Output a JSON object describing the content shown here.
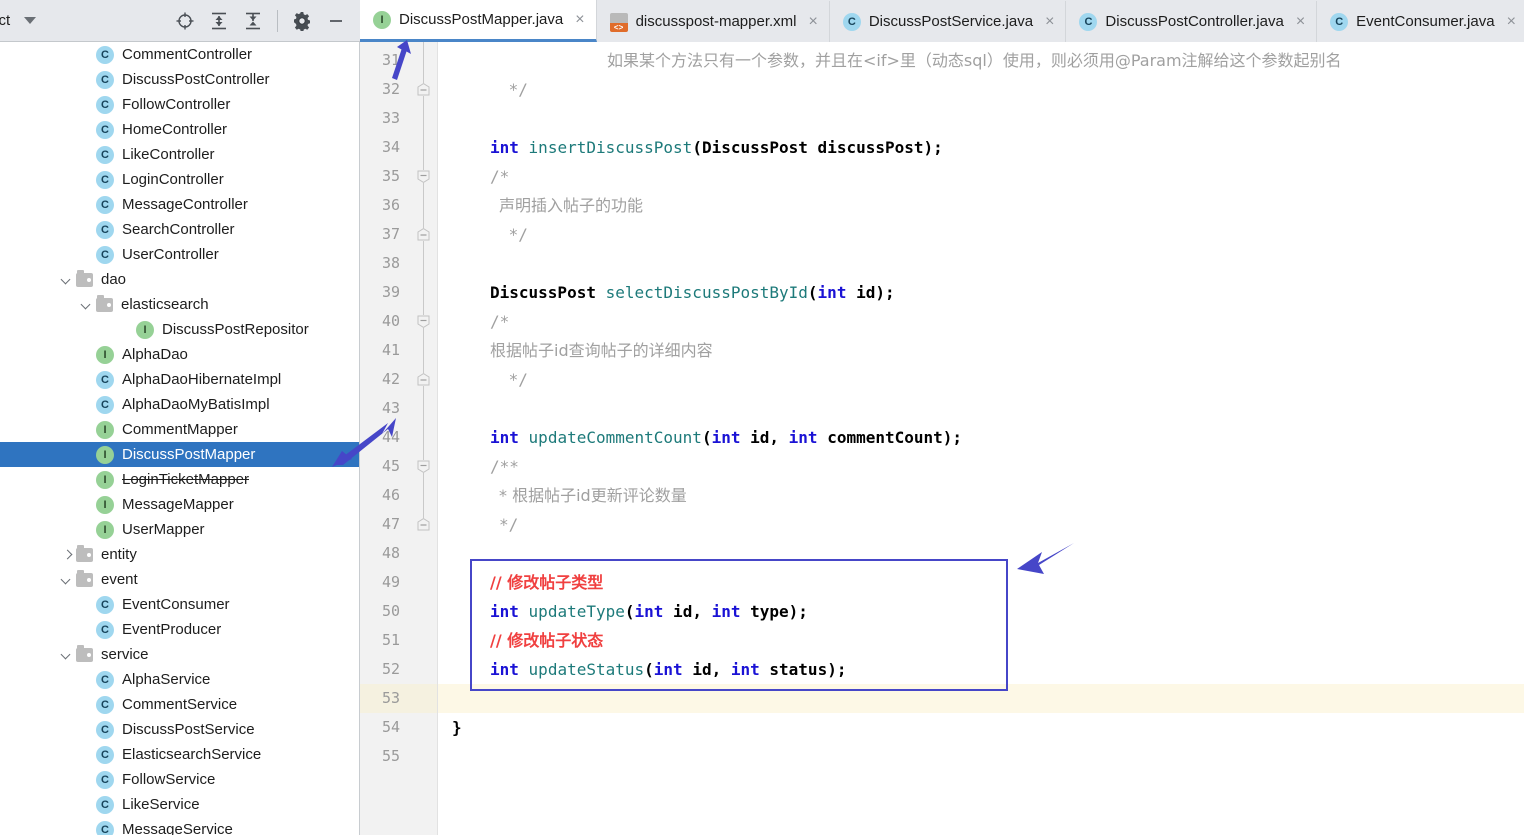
{
  "project_panel": {
    "title": "ect",
    "title_full": "Project",
    "dropdown_icon": "chevron-down-icon",
    "toolbar": [
      {
        "name": "locate-target-icon",
        "label": "Select Opened File"
      },
      {
        "name": "expand-all-icon",
        "label": "Expand All"
      },
      {
        "name": "collapse-all-icon",
        "label": "Collapse All"
      },
      {
        "name": "gear-icon",
        "label": "Settings"
      },
      {
        "name": "minimize-icon",
        "label": "Hide"
      }
    ]
  },
  "tabs": [
    {
      "label": "DiscussPostMapper.java",
      "icon": "interface-icon",
      "active": true,
      "close": "×"
    },
    {
      "label": "discusspost-mapper.xml",
      "icon": "xml-file-icon",
      "active": false,
      "close": "×"
    },
    {
      "label": "DiscussPostService.java",
      "icon": "class-icon",
      "active": false,
      "close": "×"
    },
    {
      "label": "DiscussPostController.java",
      "icon": "class-icon",
      "active": false,
      "close": "×"
    },
    {
      "label": "EventConsumer.java",
      "icon": "class-icon",
      "active": false,
      "close": "×"
    }
  ],
  "tree": [
    {
      "label": "CommentController",
      "icon": "class-icon",
      "indent": 5,
      "type": "file"
    },
    {
      "label": "DiscussPostController",
      "icon": "class-icon",
      "indent": 5,
      "type": "file"
    },
    {
      "label": "FollowController",
      "icon": "class-icon",
      "indent": 5,
      "type": "file"
    },
    {
      "label": "HomeController",
      "icon": "class-icon",
      "indent": 5,
      "type": "file"
    },
    {
      "label": "LikeController",
      "icon": "class-icon",
      "indent": 5,
      "type": "file"
    },
    {
      "label": "LoginController",
      "icon": "class-icon",
      "indent": 5,
      "type": "file"
    },
    {
      "label": "MessageController",
      "icon": "class-icon",
      "indent": 5,
      "type": "file"
    },
    {
      "label": "SearchController",
      "icon": "class-icon",
      "indent": 5,
      "type": "file"
    },
    {
      "label": "UserController",
      "icon": "class-icon",
      "indent": 5,
      "type": "file"
    },
    {
      "label": "dao",
      "icon": "folder-icon",
      "indent": 4,
      "type": "folder",
      "expanded": true
    },
    {
      "label": "elasticsearch",
      "icon": "folder-icon",
      "indent": 5,
      "type": "folder",
      "expanded": true
    },
    {
      "label": "DiscussPostRepositor",
      "icon": "interface-icon",
      "indent": 7,
      "type": "file",
      "clipped": true
    },
    {
      "label": "AlphaDao",
      "icon": "interface-icon",
      "indent": 5,
      "type": "file"
    },
    {
      "label": "AlphaDaoHibernateImpl",
      "icon": "class-icon",
      "indent": 5,
      "type": "file"
    },
    {
      "label": "AlphaDaoMyBatisImpl",
      "icon": "class-icon",
      "indent": 5,
      "type": "file"
    },
    {
      "label": "CommentMapper",
      "icon": "interface-icon",
      "indent": 5,
      "type": "file"
    },
    {
      "label": "DiscussPostMapper",
      "icon": "interface-icon",
      "indent": 5,
      "type": "file",
      "selected": true
    },
    {
      "label": "LoginTicketMapper",
      "icon": "interface-icon",
      "indent": 5,
      "type": "file",
      "strikethrough": true
    },
    {
      "label": "MessageMapper",
      "icon": "interface-icon",
      "indent": 5,
      "type": "file"
    },
    {
      "label": "UserMapper",
      "icon": "interface-icon",
      "indent": 5,
      "type": "file"
    },
    {
      "label": "entity",
      "icon": "folder-icon",
      "indent": 4,
      "type": "folder",
      "expanded": false
    },
    {
      "label": "event",
      "icon": "folder-icon",
      "indent": 4,
      "type": "folder",
      "expanded": true
    },
    {
      "label": "EventConsumer",
      "icon": "class-icon",
      "indent": 5,
      "type": "file"
    },
    {
      "label": "EventProducer",
      "icon": "class-icon",
      "indent": 5,
      "type": "file"
    },
    {
      "label": "service",
      "icon": "folder-icon",
      "indent": 4,
      "type": "folder",
      "expanded": true
    },
    {
      "label": "AlphaService",
      "icon": "class-icon",
      "indent": 5,
      "type": "file"
    },
    {
      "label": "CommentService",
      "icon": "class-icon",
      "indent": 5,
      "type": "file"
    },
    {
      "label": "DiscussPostService",
      "icon": "class-icon",
      "indent": 5,
      "type": "file"
    },
    {
      "label": "ElasticsearchService",
      "icon": "class-icon",
      "indent": 5,
      "type": "file"
    },
    {
      "label": "FollowService",
      "icon": "class-icon",
      "indent": 5,
      "type": "file"
    },
    {
      "label": "LikeService",
      "icon": "class-icon",
      "indent": 5,
      "type": "file"
    },
    {
      "label": "MessageService",
      "icon": "class-icon",
      "indent": 5,
      "type": "file"
    }
  ],
  "editor": {
    "first_line": 31,
    "last_line": 55,
    "caret_line": 53,
    "fold_lines": [
      32,
      35,
      37,
      40,
      42,
      45,
      47
    ],
    "lines": [
      {
        "n": 31,
        "indent": 13,
        "tokens": [
          {
            "t": "如果某个方法只有一个参数，并且在<if>里（动态sql）使用，则必须用@Param注解给这个参数起别名",
            "c": "cmt cmt-cn"
          }
        ]
      },
      {
        "n": 32,
        "indent": 1,
        "tokens": [
          {
            "t": " */",
            "c": "cmt"
          }
        ]
      },
      {
        "n": 33,
        "indent": 0,
        "tokens": []
      },
      {
        "n": 34,
        "indent": 0,
        "tokens": [
          {
            "t": "int",
            "c": "kw"
          },
          {
            "t": " ",
            "c": "plain"
          },
          {
            "t": "insertDiscussPost",
            "c": "mth"
          },
          {
            "t": "(",
            "c": "typ"
          },
          {
            "t": "DiscussPost",
            "c": "typ"
          },
          {
            "t": " discussPost);",
            "c": "typ"
          }
        ]
      },
      {
        "n": 35,
        "indent": 0,
        "tokens": [
          {
            "t": "/*",
            "c": "cmt"
          }
        ]
      },
      {
        "n": 36,
        "indent": 1,
        "tokens": [
          {
            "t": "声明插入帖子的功能",
            "c": "cmt cmt-cn"
          }
        ]
      },
      {
        "n": 37,
        "indent": 1,
        "tokens": [
          {
            "t": " */",
            "c": "cmt"
          }
        ]
      },
      {
        "n": 38,
        "indent": 0,
        "tokens": []
      },
      {
        "n": 39,
        "indent": 0,
        "tokens": [
          {
            "t": "DiscussPost",
            "c": "typ"
          },
          {
            "t": " ",
            "c": "plain"
          },
          {
            "t": "selectDiscussPostById",
            "c": "mth"
          },
          {
            "t": "(",
            "c": "typ"
          },
          {
            "t": "int",
            "c": "kw"
          },
          {
            "t": " id);",
            "c": "typ"
          }
        ]
      },
      {
        "n": 40,
        "indent": 0,
        "tokens": [
          {
            "t": "/*",
            "c": "cmt"
          }
        ]
      },
      {
        "n": 41,
        "indent": 0,
        "tokens": [
          {
            "t": "根据帖子id查询帖子的详细内容",
            "c": "cmt cmt-cn"
          }
        ]
      },
      {
        "n": 42,
        "indent": 1,
        "tokens": [
          {
            "t": " */",
            "c": "cmt"
          }
        ]
      },
      {
        "n": 43,
        "indent": 0,
        "tokens": []
      },
      {
        "n": 44,
        "indent": 0,
        "tokens": [
          {
            "t": "int",
            "c": "kw"
          },
          {
            "t": " ",
            "c": "plain"
          },
          {
            "t": "updateCommentCount",
            "c": "mth"
          },
          {
            "t": "(",
            "c": "typ"
          },
          {
            "t": "int",
            "c": "kw"
          },
          {
            "t": " id, ",
            "c": "typ"
          },
          {
            "t": "int",
            "c": "kw"
          },
          {
            "t": " commentCount);",
            "c": "typ"
          }
        ]
      },
      {
        "n": 45,
        "indent": 0,
        "tokens": [
          {
            "t": "/**",
            "c": "cmt"
          }
        ]
      },
      {
        "n": 46,
        "indent": 1,
        "tokens": [
          {
            "t": "* 根据帖子id更新评论数量",
            "c": "cmt cmt-cn"
          }
        ]
      },
      {
        "n": 47,
        "indent": 1,
        "tokens": [
          {
            "t": "*/",
            "c": "cmt"
          }
        ]
      },
      {
        "n": 48,
        "indent": 0,
        "tokens": []
      },
      {
        "n": 49,
        "indent": 0,
        "tokens": [
          {
            "t": "// 修改帖子类型",
            "c": "redc cmt-cn"
          }
        ]
      },
      {
        "n": 50,
        "indent": 0,
        "tokens": [
          {
            "t": "int",
            "c": "kw"
          },
          {
            "t": " ",
            "c": "plain"
          },
          {
            "t": "updateType",
            "c": "mth"
          },
          {
            "t": "(",
            "c": "typ"
          },
          {
            "t": "int",
            "c": "kw"
          },
          {
            "t": " id, ",
            "c": "typ"
          },
          {
            "t": "int",
            "c": "kw"
          },
          {
            "t": " type);",
            "c": "typ"
          }
        ]
      },
      {
        "n": 51,
        "indent": 0,
        "tokens": [
          {
            "t": "// 修改帖子状态",
            "c": "redc cmt-cn"
          }
        ]
      },
      {
        "n": 52,
        "indent": 0,
        "tokens": [
          {
            "t": "int",
            "c": "kw"
          },
          {
            "t": " ",
            "c": "plain"
          },
          {
            "t": "updateStatus",
            "c": "mth"
          },
          {
            "t": "(",
            "c": "typ"
          },
          {
            "t": "int",
            "c": "kw"
          },
          {
            "t": " id, ",
            "c": "typ"
          },
          {
            "t": "int",
            "c": "kw"
          },
          {
            "t": " status);",
            "c": "typ"
          }
        ]
      },
      {
        "n": 53,
        "indent": 0,
        "tokens": []
      },
      {
        "n": 54,
        "indent": -1,
        "tokens": [
          {
            "t": "}",
            "c": "typ"
          }
        ]
      },
      {
        "n": 55,
        "indent": 0,
        "tokens": []
      }
    ]
  },
  "annotations": {
    "box_color": "#4646c8",
    "arrow_color": "#4646c8",
    "arrows": [
      {
        "name": "annotation-arrow-tab"
      },
      {
        "name": "annotation-arrow-tree"
      },
      {
        "name": "annotation-arrow-code"
      }
    ]
  },
  "colors": {
    "selection_blue": "#2f74c0",
    "tab_active_underline": "#4a86c8",
    "caret_line": "#fdf8e6",
    "keyword": "#1a12d5",
    "method": "#1d7a7a",
    "comment": "#a0a0a0",
    "red_comment": "#f04040"
  }
}
